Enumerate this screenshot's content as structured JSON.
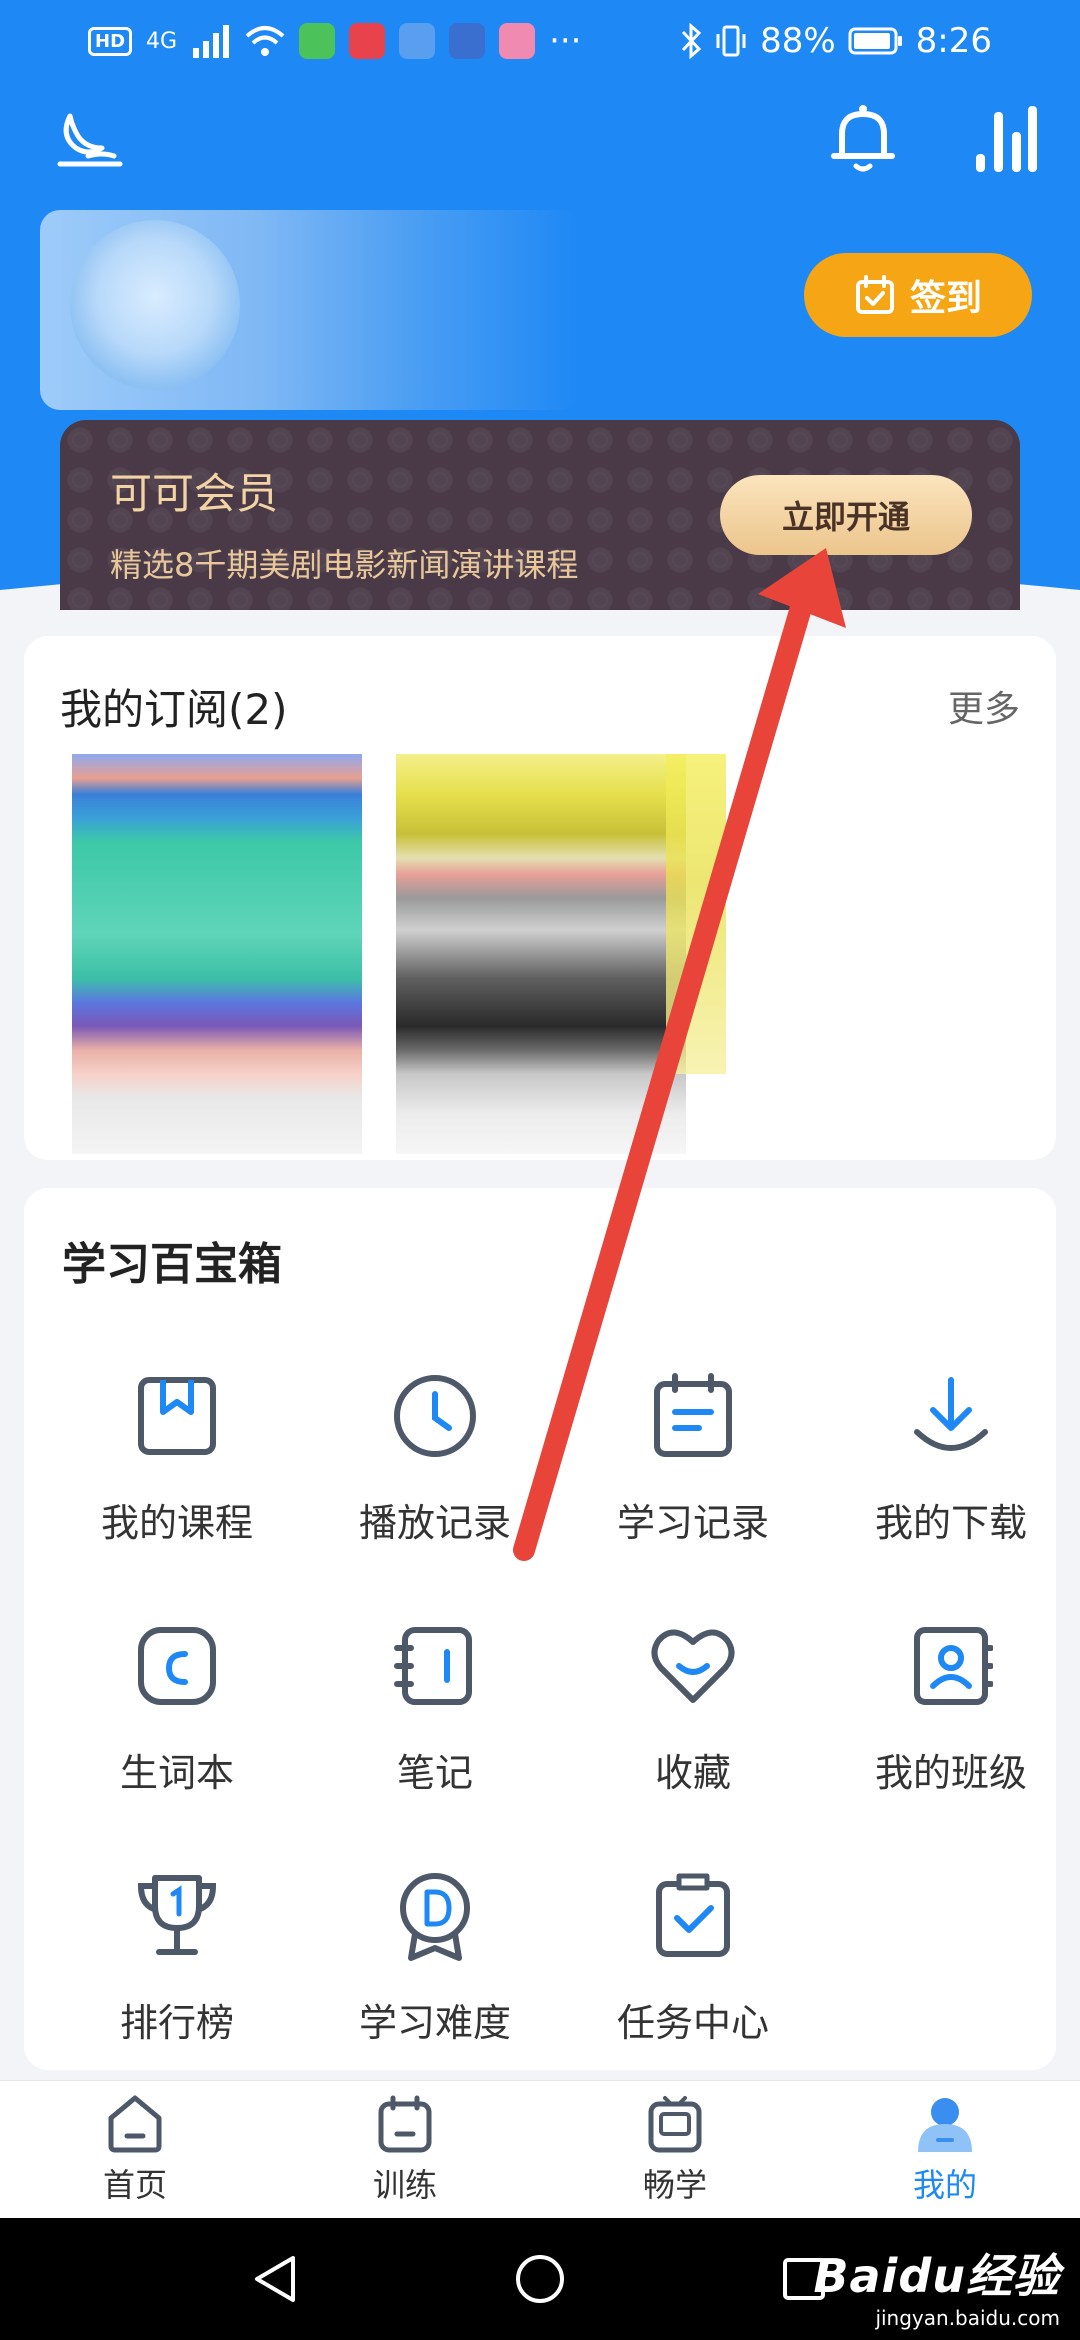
{
  "status_bar": {
    "network": "4G",
    "battery": "88%",
    "time": "8:26"
  },
  "header": {
    "checkin_label": "签到"
  },
  "vip": {
    "title": "可可会员",
    "subtitle": "精选8千期美剧电影新闻演讲课程",
    "button": "立即开通"
  },
  "subscription": {
    "title": "我的订阅(2)",
    "more": "更多"
  },
  "toolbox": {
    "title": "学习百宝箱",
    "items": [
      {
        "label": "我的课程",
        "icon": "bookmark-book-icon"
      },
      {
        "label": "播放记录",
        "icon": "clock-icon"
      },
      {
        "label": "学习记录",
        "icon": "calendar-notes-icon"
      },
      {
        "label": "我的下载",
        "icon": "download-icon"
      },
      {
        "label": "生词本",
        "icon": "vocabulary-icon"
      },
      {
        "label": "笔记",
        "icon": "notebook-icon"
      },
      {
        "label": "收藏",
        "icon": "heart-icon"
      },
      {
        "label": "我的班级",
        "icon": "class-contact-icon"
      },
      {
        "label": "排行榜",
        "icon": "trophy-icon"
      },
      {
        "label": "学习难度",
        "icon": "difficulty-medal-icon"
      },
      {
        "label": "任务中心",
        "icon": "task-clipboard-icon"
      }
    ]
  },
  "bottom_nav": {
    "items": [
      {
        "label": "首页",
        "icon": "home-icon"
      },
      {
        "label": "训练",
        "icon": "training-icon"
      },
      {
        "label": "畅学",
        "icon": "video-icon"
      },
      {
        "label": "我的",
        "icon": "profile-icon"
      }
    ],
    "active": "我的"
  },
  "watermark": {
    "logo": "Baidu经验",
    "url": "jingyan.baidu.com"
  },
  "colors": {
    "brand_blue": "#1e88f5",
    "checkin_orange": "#f6a515",
    "vip_gold": "#f2d3a4",
    "annotation_red": "#e8443a"
  }
}
